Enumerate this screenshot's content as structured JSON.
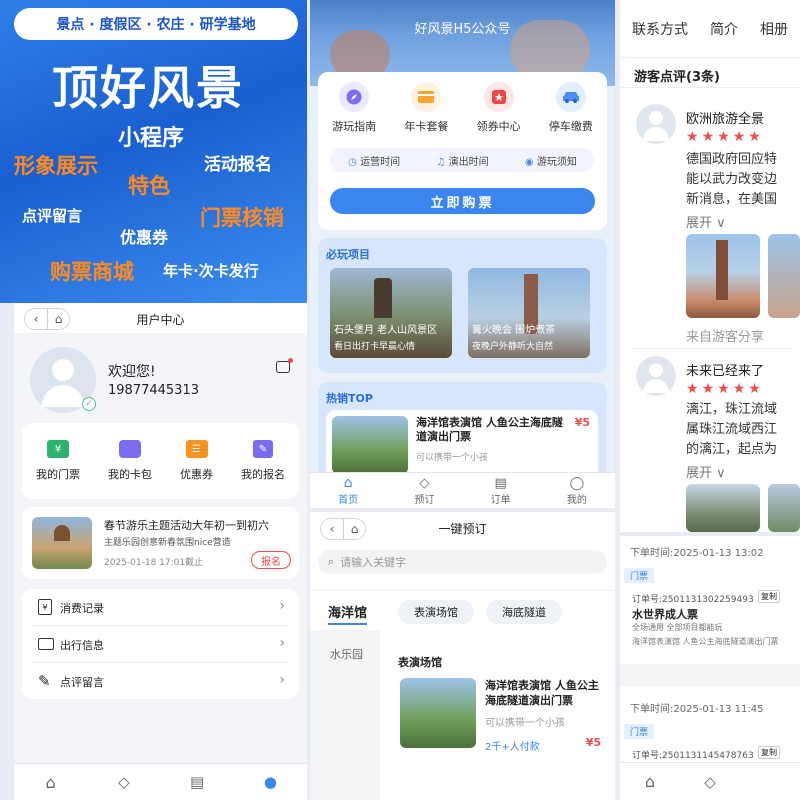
{
  "promo": {
    "pill": "景点 · 度假区 · 农庄 · 研学基地",
    "title": "顶好风景",
    "keywords": [
      "小程序",
      "形象展示",
      "活动报名",
      "特色",
      "点评留言",
      "门票核销",
      "优惠券",
      "购票商城",
      "年卡·次卡发行"
    ]
  },
  "home": {
    "header_title": "好风景H5公众号",
    "quick": [
      {
        "label": "游玩指南",
        "icon": "compass-icon"
      },
      {
        "label": "年卡套餐",
        "icon": "card-icon"
      },
      {
        "label": "领券中心",
        "icon": "coupon-icon"
      },
      {
        "label": "停车缴费",
        "icon": "car-icon"
      }
    ],
    "info": [
      "运营时间",
      "演出时间",
      "游玩须知"
    ],
    "buy_button": "立即购票",
    "must_title": "必玩项目",
    "must": [
      {
        "title": "石头堡月 老人山风景区",
        "sub": "看日出打卡早晨心情"
      },
      {
        "title": "篝火晚会 围炉煮茶",
        "sub": "夜晚户外静听大自然"
      }
    ],
    "hot_title": "热销TOP",
    "hot_item": {
      "title": "海洋馆表演馆 人鱼公主海底隧道演出门票",
      "sub": "可以携带一个小孩",
      "price": "¥5"
    },
    "tabs": [
      "首页",
      "预订",
      "订单",
      "我的"
    ]
  },
  "reviews": {
    "tabs": [
      "联系方式",
      "简介",
      "相册"
    ],
    "section_title": "游客点评(3条)",
    "items": [
      {
        "name": "欧洲旅游全景",
        "stars": 5,
        "text": [
          "德国政府回应特",
          "能以武力改变边",
          "新消息，在美国"
        ],
        "expand": "展开",
        "from": "来自游客分享"
      },
      {
        "name": "未来已经来了",
        "stars": 5,
        "text": [
          "漓江，珠江流域",
          "属珠江流域西江",
          "的漓江，起点为"
        ],
        "expand": "展开"
      }
    ]
  },
  "user": {
    "title": "用户中心",
    "welcome": "欢迎您!",
    "phone": "19877445313",
    "grid": [
      {
        "label": "我的门票",
        "icon": "ticket-icon"
      },
      {
        "label": "我的卡包",
        "icon": "wallet-icon"
      },
      {
        "label": "优惠券",
        "icon": "coupon-icon"
      },
      {
        "label": "我的报名",
        "icon": "form-icon"
      }
    ],
    "event": {
      "title": "春节游乐主题活动大年初一到初六",
      "sub": "主题乐园创意新春氛围nice营造",
      "deadline": "2025-01-18 17:01截止",
      "button": "报名"
    },
    "list": [
      {
        "label": "消费记录",
        "icon": "receipt-icon"
      },
      {
        "label": "出行信息",
        "icon": "id-card-icon"
      },
      {
        "label": "点评留言",
        "icon": "edit-icon"
      }
    ]
  },
  "booking": {
    "title": "一键预订",
    "search_placeholder": "请输入关键字",
    "side": [
      "海洋馆",
      "水乐园"
    ],
    "chips": [
      "表演场馆",
      "海底隧道"
    ],
    "section": "表演场馆",
    "item": {
      "title": "海洋馆表演馆 人鱼公主海底隧道演出门票",
      "sub": "可以携带一个小孩",
      "count": "2千+人付款",
      "price": "¥5"
    }
  },
  "orders": {
    "items": [
      {
        "time_label": "下单时间:",
        "time": "2025-01-13 13:02",
        "tag": "门票",
        "no_label": "订单号:",
        "no": "2501131302259493",
        "copy": "复制",
        "name": "水世界成人票",
        "desc": "全场通用 全部项目都能玩",
        "desc2": "海洋馆表演馆 人鱼公主海底隧道演出门票"
      },
      {
        "time_label": "下单时间:",
        "time": "2025-01-13 11:45",
        "tag": "门票",
        "no_label": "订单号:",
        "no": "2501131145478763",
        "copy": "复制"
      }
    ]
  },
  "colors": {
    "brand": "#3a86f0",
    "price": "#f24b4b",
    "orange": "#f7931e"
  }
}
